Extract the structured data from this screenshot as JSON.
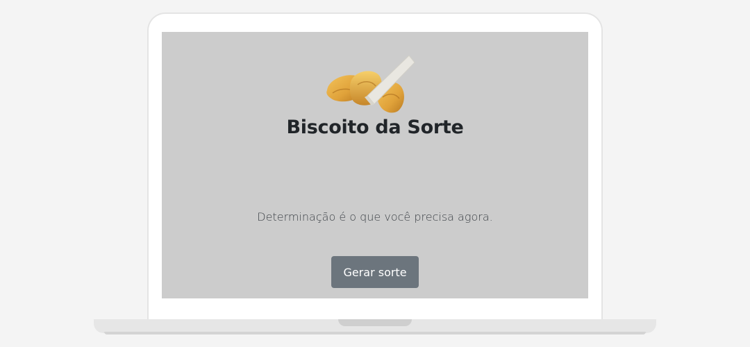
{
  "app": {
    "title": "Biscoito da Sorte",
    "fortune_message": "Determinação é o que você precisa agora.",
    "button_label": "Gerar sorte"
  },
  "icons": {
    "hero_image": "fortune-cookie-image"
  },
  "colors": {
    "page_background": "#f4f4f4",
    "screen_background": "#cccccc",
    "button_background": "#6c757d",
    "title_color": "#212529"
  }
}
